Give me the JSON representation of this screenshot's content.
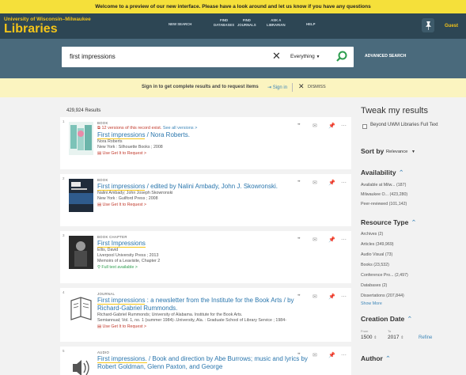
{
  "notice": "Welcome to a preview of our new interface. Please have a look around and let us know if you have any questions",
  "header": {
    "brand_top": "University of Wisconsin–Milwaukee",
    "brand_main": "Libraries",
    "nav": [
      {
        "line1": "NEW SEARCH",
        "line2": ""
      },
      {
        "line1": "FIND",
        "line2": "DATABASES"
      },
      {
        "line1": "FIND",
        "line2": "JOURNALS"
      },
      {
        "line1": "ASK A",
        "line2": "LIBRARIAN"
      },
      {
        "line1": "HELP",
        "line2": ""
      }
    ],
    "user": "Guest"
  },
  "search": {
    "query": "first impressions",
    "scope": "Everything",
    "advanced": "ADVANCED SEARCH"
  },
  "signin_bar": {
    "message": "Sign in to get complete results and to request items",
    "signin": "Sign in",
    "dismiss": "DISMISS"
  },
  "results": {
    "count": "429,924 Results",
    "items": [
      {
        "index": "1",
        "type": "BOOK",
        "versions": "12 versions of this record exist.",
        "versions_link": "See all versions >",
        "title_hl": "First impressions",
        "title_rest": " / Nora Roberts.",
        "meta": [
          "Nora Roberts",
          "New York : Silhouette Books ; 2008"
        ],
        "availability": "Use Get It to Request >"
      },
      {
        "index": "2",
        "type": "BOOK",
        "title_hl": "First impressions",
        "title_rest": " / edited by Nalini Ambady, John J. Skowronski.",
        "meta": [
          "Nalini Ambady; John Joseph Skowronski",
          "New York : Guilford Press ; 2008"
        ],
        "availability": "Use Get It to Request >"
      },
      {
        "index": "3",
        "type": "BOOK CHAPTER",
        "title_hl": "First Impressions",
        "title_rest": "",
        "meta": [
          "Ellis, David",
          "Liverpool University Press ; 2013",
          "Memoirs of a Leavisite, Chapter 2"
        ],
        "availability": "Full text available >"
      },
      {
        "index": "4",
        "type": "JOURNAL",
        "title_hl": "First impressions",
        "title_rest": " : a newsletter from the Institute for the Book Arts / by Richard-Gabriel Rummonds.",
        "meta": [
          "Richard-Gabriel Rummonds; University of Alabama. Institute for the Book Arts.",
          "Semiannual; Vol. 1, no. 1 (summer 1984)-.University, Ala. : Graduate School of Library Service ; 1984-"
        ],
        "availability": "Use Get It to Request >"
      },
      {
        "index": "5",
        "type": "AUDIO",
        "title_hl": "First impressions.",
        "title_rest": " / Book and direction by Abe Burrows; music and lyrics by Robert Goldman, Glenn Paxton, and George",
        "meta": [],
        "availability": ""
      }
    ]
  },
  "sidebar": {
    "title": "Tweak my results",
    "beyond": "Beyond UWM Libraries Full Text",
    "sort_label": "Sort by",
    "sort_value": "Relevance",
    "availability_hdr": "Availability",
    "availability": [
      {
        "label": "Available at Milw...",
        "count": "(187)"
      },
      {
        "label": "Milwaukee O...",
        "count": "(423,280)"
      },
      {
        "label": "Peer-reviewed",
        "count": "(101,142)"
      }
    ],
    "resource_hdr": "Resource Type",
    "resources": [
      {
        "label": "Archives",
        "count": "(2)"
      },
      {
        "label": "Articles",
        "count": "(349,969)"
      },
      {
        "label": "Audio Visual",
        "count": "(73)"
      },
      {
        "label": "Books",
        "count": "(23,532)"
      },
      {
        "label": "Conference Pro...",
        "count": "(2,497)"
      },
      {
        "label": "Databases",
        "count": "(2)"
      },
      {
        "label": "Dissertations",
        "count": "(207,844)"
      }
    ],
    "show_more": "Show More",
    "creation_hdr": "Creation Date",
    "from_label": "From",
    "to_label": "To",
    "from": "1500",
    "to": "2017",
    "refine": "Refine",
    "author_hdr": "Author"
  },
  "colors": {
    "notice_bg": "#f5e03a",
    "header_bg": "#2d4654",
    "band_bg": "#4a6a7c",
    "brand": "#f5c518",
    "link": "#2a76ad",
    "highlight": "#f5c518",
    "available": "#2e9d4f",
    "request": "#c0392b"
  },
  "icons": [
    "search-icon",
    "clear-icon",
    "pin-icon",
    "quote-icon",
    "email-icon",
    "more-icon",
    "sign-in-icon",
    "close-icon",
    "chevron-down-icon",
    "chevron-up-icon",
    "book-icon",
    "audio-icon"
  ]
}
